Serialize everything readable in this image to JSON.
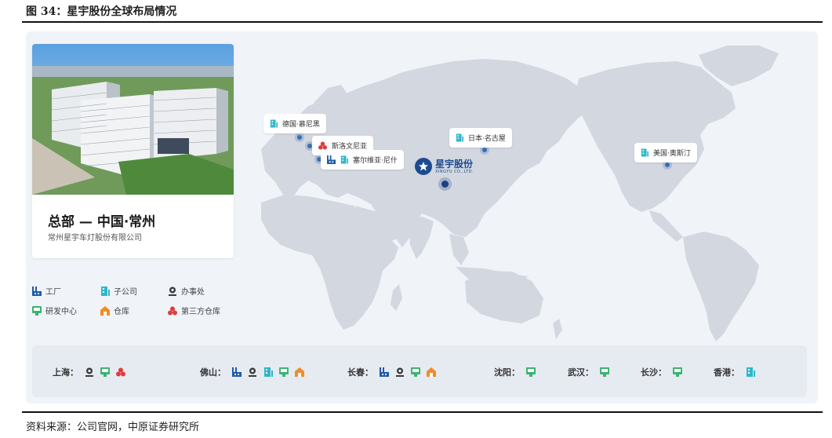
{
  "figure_title": "图 34：星宇股份全球布局情况",
  "source_note": "资料来源：公司官网，中原证券研究所",
  "headquarters": {
    "title": "总部 — 中国·常州",
    "subtitle": "常州星宇车灯股份有限公司"
  },
  "company_logo": {
    "name_cn": "星宇股份",
    "name_en": "XINGYU CO.,LTD."
  },
  "legend": [
    {
      "label": "工厂",
      "icon": "factory-icon"
    },
    {
      "label": "子公司",
      "icon": "subsidiary-icon"
    },
    {
      "label": "办事处",
      "icon": "office-icon"
    },
    {
      "label": "研发中心",
      "icon": "rnd-center-icon"
    },
    {
      "label": "仓库",
      "icon": "warehouse-icon"
    },
    {
      "label": "第三方仓库",
      "icon": "third-party-warehouse-icon"
    }
  ],
  "map_locations": [
    {
      "label": "德国·慕尼黑",
      "icons": [
        "subsidiary-icon"
      ]
    },
    {
      "label": "斯洛文尼亚",
      "icons": [
        "third-party-warehouse-icon"
      ]
    },
    {
      "label": "塞尔维亚·尼什",
      "icons": [
        "factory-icon",
        "subsidiary-icon"
      ]
    },
    {
      "label": "日本·名古屋",
      "icons": [
        "subsidiary-icon"
      ]
    },
    {
      "label": "美国·奥斯汀",
      "icons": [
        "subsidiary-icon"
      ]
    }
  ],
  "domestic_sites": [
    {
      "city": "上海：",
      "icons": [
        "office-icon",
        "rnd-center-icon",
        "third-party-warehouse-icon"
      ]
    },
    {
      "city": "佛山：",
      "icons": [
        "factory-icon",
        "office-icon",
        "subsidiary-icon",
        "rnd-center-icon",
        "warehouse-icon"
      ]
    },
    {
      "city": "长春：",
      "icons": [
        "factory-icon",
        "office-icon",
        "rnd-center-icon",
        "warehouse-icon"
      ]
    },
    {
      "city": "沈阳：",
      "icons": [
        "rnd-center-icon"
      ]
    },
    {
      "city": "武汉：",
      "icons": [
        "rnd-center-icon"
      ]
    },
    {
      "city": "长沙：",
      "icons": [
        "rnd-center-icon"
      ]
    },
    {
      "city": "香港：",
      "icons": [
        "subsidiary-icon"
      ]
    }
  ],
  "colors": {
    "factory": "#1f5aa6",
    "subsidiary": "#2fb7c9",
    "office": "#3a3a3a",
    "rnd_center": "#3cb371",
    "warehouse": "#f28c28",
    "third_party_warehouse": "#e23b3b",
    "map_land": "#d3d7df",
    "panel_bg": "#f0f3f8"
  }
}
